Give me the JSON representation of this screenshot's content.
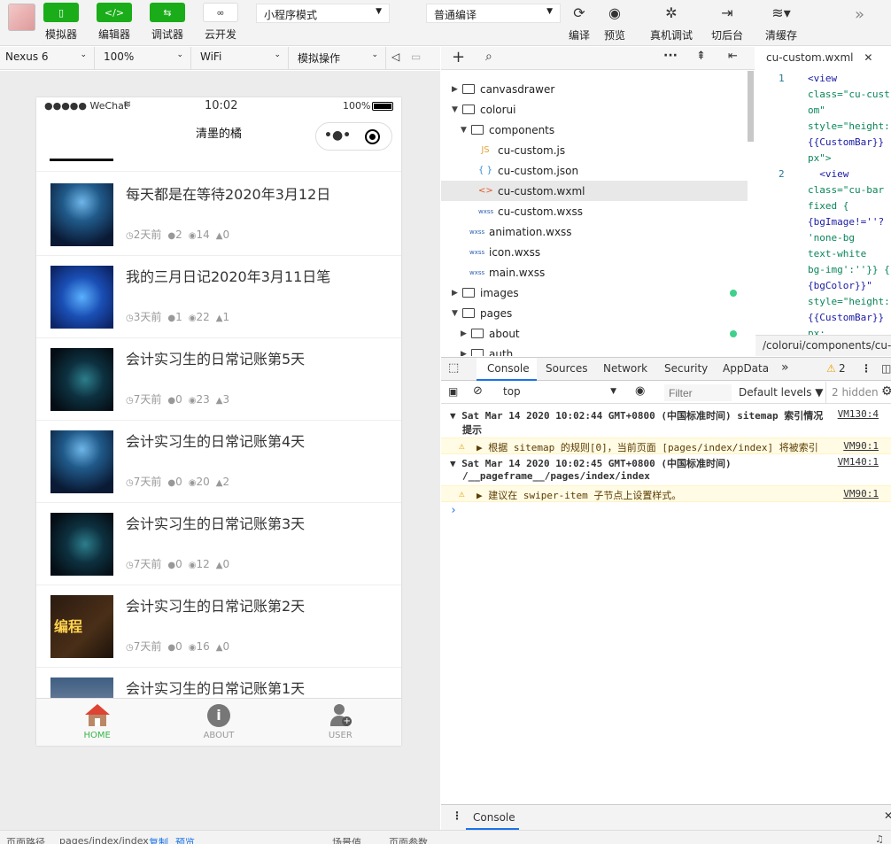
{
  "toolbar": {
    "buttons": [
      {
        "label": "模拟器",
        "icon": "phone-icon"
      },
      {
        "label": "编辑器",
        "icon": "code-icon"
      },
      {
        "label": "调试器",
        "icon": "debug-icon"
      },
      {
        "label": "云开发",
        "icon": "cloud-icon"
      }
    ],
    "mode_select": "小程序模式",
    "compile_select": "普通编译",
    "actions": [
      {
        "label": "编译",
        "icon": "refresh-icon"
      },
      {
        "label": "预览",
        "icon": "eye-icon"
      },
      {
        "label": "真机调试",
        "icon": "bug-icon"
      },
      {
        "label": "切后台",
        "icon": "switch-icon"
      },
      {
        "label": "清缓存",
        "icon": "layers-icon"
      }
    ],
    "more": "»"
  },
  "devbar": {
    "device": "Nexus 6",
    "zoom": "100%",
    "network": "WiFi",
    "operation": "模拟操作"
  },
  "phone": {
    "status_left": "●●●●● WeChat",
    "status_time": "10:02",
    "status_battery": "100%",
    "nav_title": "清墨的橘",
    "posts": [
      {
        "title": "每天都是在等待2020年3月12日",
        "time": "2天前",
        "comments": "2",
        "views": "14",
        "likes": "0",
        "thumb": "hacker"
      },
      {
        "title": "我的三月日记2020年3月11日笔",
        "time": "3天前",
        "comments": "1",
        "views": "22",
        "likes": "1",
        "thumb": "shield"
      },
      {
        "title": "会计实习生的日常记账第5天",
        "time": "7天前",
        "comments": "0",
        "views": "23",
        "likes": "3",
        "thumb": "dark"
      },
      {
        "title": "会计实习生的日常记账第4天",
        "time": "7天前",
        "comments": "0",
        "views": "20",
        "likes": "2",
        "thumb": "hacker"
      },
      {
        "title": "会计实习生的日常记账第3天",
        "time": "7天前",
        "comments": "0",
        "views": "12",
        "likes": "0",
        "thumb": "dark"
      },
      {
        "title": "会计实习生的日常记账第2天",
        "time": "7天前",
        "comments": "0",
        "views": "16",
        "likes": "0",
        "thumb": "coding"
      },
      {
        "title": "会计实习生的日常记账第1天",
        "time": "",
        "comments": "",
        "views": "",
        "likes": "",
        "thumb": "city"
      }
    ],
    "coding_thumb_text": "编程",
    "tabs": [
      {
        "label": "HOME",
        "icon": "home-icon",
        "active": true
      },
      {
        "label": "ABOUT",
        "icon": "info-icon",
        "active": false
      },
      {
        "label": "USER",
        "icon": "user-add-icon",
        "active": false
      }
    ]
  },
  "tree": {
    "nodes": [
      {
        "label": "canvasdrawer",
        "type": "folder",
        "open": false,
        "depth": 0
      },
      {
        "label": "colorui",
        "type": "folder",
        "open": true,
        "depth": 0
      },
      {
        "label": "components",
        "type": "folder",
        "open": true,
        "depth": 1
      },
      {
        "label": "cu-custom.js",
        "type": "js",
        "depth": 2
      },
      {
        "label": "cu-custom.json",
        "type": "json",
        "depth": 2
      },
      {
        "label": "cu-custom.wxml",
        "type": "wxml",
        "depth": 2,
        "selected": true
      },
      {
        "label": "cu-custom.wxss",
        "type": "wxss",
        "depth": 2
      },
      {
        "label": "animation.wxss",
        "type": "wxss",
        "depth": 1
      },
      {
        "label": "icon.wxss",
        "type": "wxss",
        "depth": 1
      },
      {
        "label": "main.wxss",
        "type": "wxss",
        "depth": 1
      },
      {
        "label": "images",
        "type": "folder",
        "open": false,
        "depth": 0,
        "dot": true
      },
      {
        "label": "pages",
        "type": "folder",
        "open": true,
        "depth": 0
      },
      {
        "label": "about",
        "type": "folder",
        "open": false,
        "depth": 1,
        "dot": true
      },
      {
        "label": "auth",
        "type": "folder",
        "open": false,
        "depth": 1
      }
    ],
    "icon_labels": {
      "js": "JS",
      "json": "{ }",
      "wxml": "<>",
      "wxss": "wxss"
    }
  },
  "editor": {
    "tab_label": "cu-custom.wxml",
    "lines": [
      {
        "num": "1",
        "text": "<view",
        "color": "blue"
      },
      {
        "num": "",
        "text": "class=\"cu-cust",
        "color": "green"
      },
      {
        "num": "",
        "text": "om\"",
        "color": "green"
      },
      {
        "num": "",
        "text": "style=\"height:",
        "color": "green"
      },
      {
        "num": "",
        "text": "{{CustomBar}}",
        "color": "blue"
      },
      {
        "num": "",
        "text": "px\">",
        "color": "green"
      },
      {
        "num": "2",
        "text": "  <view",
        "color": "blue"
      },
      {
        "num": "",
        "text": "class=\"cu-bar",
        "color": "green"
      },
      {
        "num": "",
        "text": "fixed {",
        "color": "green"
      },
      {
        "num": "",
        "text": "{bgImage!=''?",
        "color": "blue"
      },
      {
        "num": "",
        "text": "'none-bg",
        "color": "green"
      },
      {
        "num": "",
        "text": "text-white",
        "color": "green"
      },
      {
        "num": "",
        "text": "bg-img':''}} {",
        "color": "green"
      },
      {
        "num": "",
        "text": "{bgColor}}\"",
        "color": "blue"
      },
      {
        "num": "",
        "text": "style=\"height:",
        "color": "green"
      },
      {
        "num": "",
        "text": "{{CustomBar}}",
        "color": "blue"
      },
      {
        "num": "",
        "text": "px;",
        "color": "green"
      }
    ],
    "path": "/colorui/components/cu-cus"
  },
  "devtools": {
    "tabs": [
      "Console",
      "Sources",
      "Network",
      "Security",
      "AppData",
      "»"
    ],
    "warn_count": "2",
    "context": "top",
    "filter_placeholder": "Filter",
    "levels": "Default levels ▼",
    "hidden": "2 hidden",
    "messages": [
      {
        "kind": "group",
        "text": "▼ Sat Mar 14 2020 10:02:44 GMT+0800 (中国标准时间) sitemap 索引情况",
        "text2": "提示",
        "src": "VM130:4"
      },
      {
        "kind": "warn",
        "text": "▶ 根据 sitemap 的规则[0]，当前页面 [pages/index/index] 将被索引",
        "src": "VM90:1"
      },
      {
        "kind": "group",
        "text": "▼ Sat Mar 14 2020 10:02:45 GMT+0800 (中国标准时间)",
        "text2": "/__pageframe__/pages/index/index",
        "src": "VM140:1"
      },
      {
        "kind": "warn",
        "text": "▶ 建议在 swiper-item 子节点上设置样式。",
        "src": "VM90:1"
      }
    ],
    "prompt": "›",
    "drawer_tab": "Console"
  },
  "footer": {
    "path_label": "页面路径",
    "path_value": "pages/index/index",
    "copy": "复制",
    "preview": "预览",
    "scene": "场景值",
    "params": "页面参数"
  }
}
